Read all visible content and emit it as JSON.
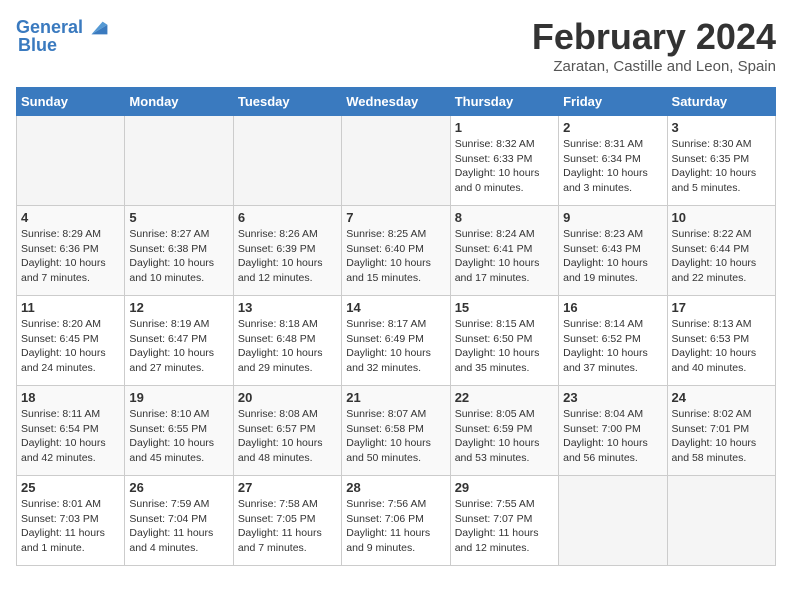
{
  "header": {
    "logo_line1": "General",
    "logo_line2": "Blue",
    "month": "February 2024",
    "location": "Zaratan, Castille and Leon, Spain"
  },
  "days_of_week": [
    "Sunday",
    "Monday",
    "Tuesday",
    "Wednesday",
    "Thursday",
    "Friday",
    "Saturday"
  ],
  "weeks": [
    [
      {
        "day": "",
        "info": ""
      },
      {
        "day": "",
        "info": ""
      },
      {
        "day": "",
        "info": ""
      },
      {
        "day": "",
        "info": ""
      },
      {
        "day": "1",
        "info": "Sunrise: 8:32 AM\nSunset: 6:33 PM\nDaylight: 10 hours\nand 0 minutes."
      },
      {
        "day": "2",
        "info": "Sunrise: 8:31 AM\nSunset: 6:34 PM\nDaylight: 10 hours\nand 3 minutes."
      },
      {
        "day": "3",
        "info": "Sunrise: 8:30 AM\nSunset: 6:35 PM\nDaylight: 10 hours\nand 5 minutes."
      }
    ],
    [
      {
        "day": "4",
        "info": "Sunrise: 8:29 AM\nSunset: 6:36 PM\nDaylight: 10 hours\nand 7 minutes."
      },
      {
        "day": "5",
        "info": "Sunrise: 8:27 AM\nSunset: 6:38 PM\nDaylight: 10 hours\nand 10 minutes."
      },
      {
        "day": "6",
        "info": "Sunrise: 8:26 AM\nSunset: 6:39 PM\nDaylight: 10 hours\nand 12 minutes."
      },
      {
        "day": "7",
        "info": "Sunrise: 8:25 AM\nSunset: 6:40 PM\nDaylight: 10 hours\nand 15 minutes."
      },
      {
        "day": "8",
        "info": "Sunrise: 8:24 AM\nSunset: 6:41 PM\nDaylight: 10 hours\nand 17 minutes."
      },
      {
        "day": "9",
        "info": "Sunrise: 8:23 AM\nSunset: 6:43 PM\nDaylight: 10 hours\nand 19 minutes."
      },
      {
        "day": "10",
        "info": "Sunrise: 8:22 AM\nSunset: 6:44 PM\nDaylight: 10 hours\nand 22 minutes."
      }
    ],
    [
      {
        "day": "11",
        "info": "Sunrise: 8:20 AM\nSunset: 6:45 PM\nDaylight: 10 hours\nand 24 minutes."
      },
      {
        "day": "12",
        "info": "Sunrise: 8:19 AM\nSunset: 6:47 PM\nDaylight: 10 hours\nand 27 minutes."
      },
      {
        "day": "13",
        "info": "Sunrise: 8:18 AM\nSunset: 6:48 PM\nDaylight: 10 hours\nand 29 minutes."
      },
      {
        "day": "14",
        "info": "Sunrise: 8:17 AM\nSunset: 6:49 PM\nDaylight: 10 hours\nand 32 minutes."
      },
      {
        "day": "15",
        "info": "Sunrise: 8:15 AM\nSunset: 6:50 PM\nDaylight: 10 hours\nand 35 minutes."
      },
      {
        "day": "16",
        "info": "Sunrise: 8:14 AM\nSunset: 6:52 PM\nDaylight: 10 hours\nand 37 minutes."
      },
      {
        "day": "17",
        "info": "Sunrise: 8:13 AM\nSunset: 6:53 PM\nDaylight: 10 hours\nand 40 minutes."
      }
    ],
    [
      {
        "day": "18",
        "info": "Sunrise: 8:11 AM\nSunset: 6:54 PM\nDaylight: 10 hours\nand 42 minutes."
      },
      {
        "day": "19",
        "info": "Sunrise: 8:10 AM\nSunset: 6:55 PM\nDaylight: 10 hours\nand 45 minutes."
      },
      {
        "day": "20",
        "info": "Sunrise: 8:08 AM\nSunset: 6:57 PM\nDaylight: 10 hours\nand 48 minutes."
      },
      {
        "day": "21",
        "info": "Sunrise: 8:07 AM\nSunset: 6:58 PM\nDaylight: 10 hours\nand 50 minutes."
      },
      {
        "day": "22",
        "info": "Sunrise: 8:05 AM\nSunset: 6:59 PM\nDaylight: 10 hours\nand 53 minutes."
      },
      {
        "day": "23",
        "info": "Sunrise: 8:04 AM\nSunset: 7:00 PM\nDaylight: 10 hours\nand 56 minutes."
      },
      {
        "day": "24",
        "info": "Sunrise: 8:02 AM\nSunset: 7:01 PM\nDaylight: 10 hours\nand 58 minutes."
      }
    ],
    [
      {
        "day": "25",
        "info": "Sunrise: 8:01 AM\nSunset: 7:03 PM\nDaylight: 11 hours\nand 1 minute."
      },
      {
        "day": "26",
        "info": "Sunrise: 7:59 AM\nSunset: 7:04 PM\nDaylight: 11 hours\nand 4 minutes."
      },
      {
        "day": "27",
        "info": "Sunrise: 7:58 AM\nSunset: 7:05 PM\nDaylight: 11 hours\nand 7 minutes."
      },
      {
        "day": "28",
        "info": "Sunrise: 7:56 AM\nSunset: 7:06 PM\nDaylight: 11 hours\nand 9 minutes."
      },
      {
        "day": "29",
        "info": "Sunrise: 7:55 AM\nSunset: 7:07 PM\nDaylight: 11 hours\nand 12 minutes."
      },
      {
        "day": "",
        "info": ""
      },
      {
        "day": "",
        "info": ""
      }
    ]
  ]
}
